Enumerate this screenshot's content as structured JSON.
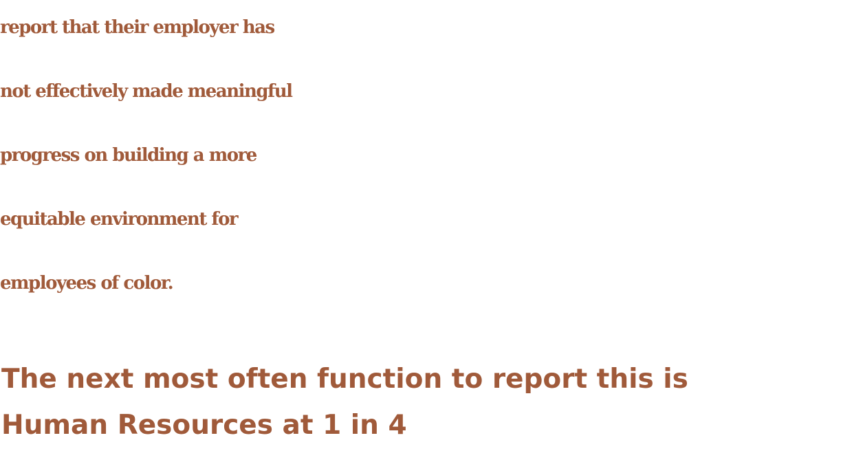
{
  "headline": {
    "lines": [
      "report that their employer has",
      "not effectively made meaningful",
      "progress on building a more",
      "equitable environment for",
      "employees of color."
    ]
  },
  "subtext": {
    "lines": [
      "The next most often function to report this is",
      "Human Resources at 1 in 4"
    ]
  },
  "colors": {
    "text": "#a05a3a",
    "background": "#ffffff"
  }
}
